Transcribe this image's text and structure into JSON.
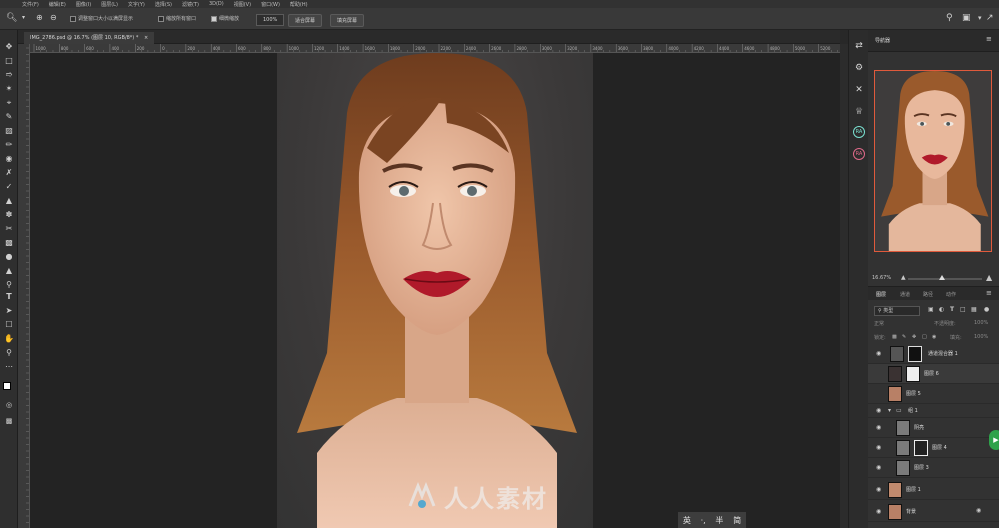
{
  "menubar": {
    "items": [
      "文件(F)",
      "编辑(E)",
      "图像(I)",
      "图层(L)",
      "文字(Y)",
      "选择(S)",
      "滤镜(T)",
      "3D(D)",
      "视图(V)",
      "窗口(W)",
      "帮助(H)"
    ]
  },
  "options_bar": {
    "resize_windows_label": "调整窗口大小以满屏显示",
    "zoom_all_label": "缩放所有窗口",
    "scrubby_zoom_label": "细微缩放",
    "scrubby_zoom_checked": true,
    "zoom_value": "100%",
    "fit_screen_label": "适合屏幕",
    "fill_screen_label": "填充屏幕"
  },
  "document": {
    "tab_label": "IMG_2786.psd @ 16.7% (图层 10, RGB/8*) *",
    "close_glyph": "×"
  },
  "ruler": {
    "h_ticks": [
      "1000",
      "800",
      "600",
      "400",
      "200",
      "0",
      "200",
      "400",
      "600",
      "800",
      "1000",
      "1200",
      "1400",
      "1600",
      "1800",
      "2000",
      "2200",
      "2400",
      "2600",
      "2800",
      "3000",
      "3200",
      "3400",
      "3600",
      "3800",
      "4000",
      "4200",
      "4400",
      "4600",
      "4800",
      "5000",
      "5200"
    ]
  },
  "ime": {
    "lang": "英",
    "sep": "·,",
    "width": "半",
    "script": "简"
  },
  "watermark": {
    "text": "人人素材"
  },
  "navigator": {
    "title": "导航器",
    "zoom": "16.67%"
  },
  "layers_panel": {
    "tabs": [
      {
        "label": "图层",
        "active": true
      },
      {
        "label": "通道",
        "active": false
      },
      {
        "label": "路径",
        "active": false
      },
      {
        "label": "动作",
        "active": false
      }
    ],
    "filter_kind": "类型",
    "blend_mode": "正常",
    "opacity_label": "不透明度:",
    "opacity_value": "100%",
    "lock_label": "锁定:",
    "fill_label": "填充:",
    "fill_value": "100%",
    "layers": [
      {
        "name": "通道混合器 1",
        "type": "adjustment",
        "visible": true
      },
      {
        "name": "图层 6",
        "type": "masked",
        "visible": false
      },
      {
        "name": "图层 5",
        "type": "photo",
        "visible": false
      },
      {
        "name": "组 1",
        "type": "group",
        "visible": true
      },
      {
        "name": "阴亮",
        "type": "gray",
        "visible": true
      },
      {
        "name": "图层 4",
        "type": "masked-gray",
        "visible": true
      },
      {
        "name": "图层 3",
        "type": "gray",
        "visible": true
      },
      {
        "name": "图层 1",
        "type": "photo",
        "visible": true
      },
      {
        "name": "背景",
        "type": "photo",
        "visible": true,
        "locked": true
      }
    ]
  },
  "colors": {
    "accent_selection": "#e05a3c",
    "lip_red": "#b01a2a",
    "green_widget": "#2fa24b"
  }
}
